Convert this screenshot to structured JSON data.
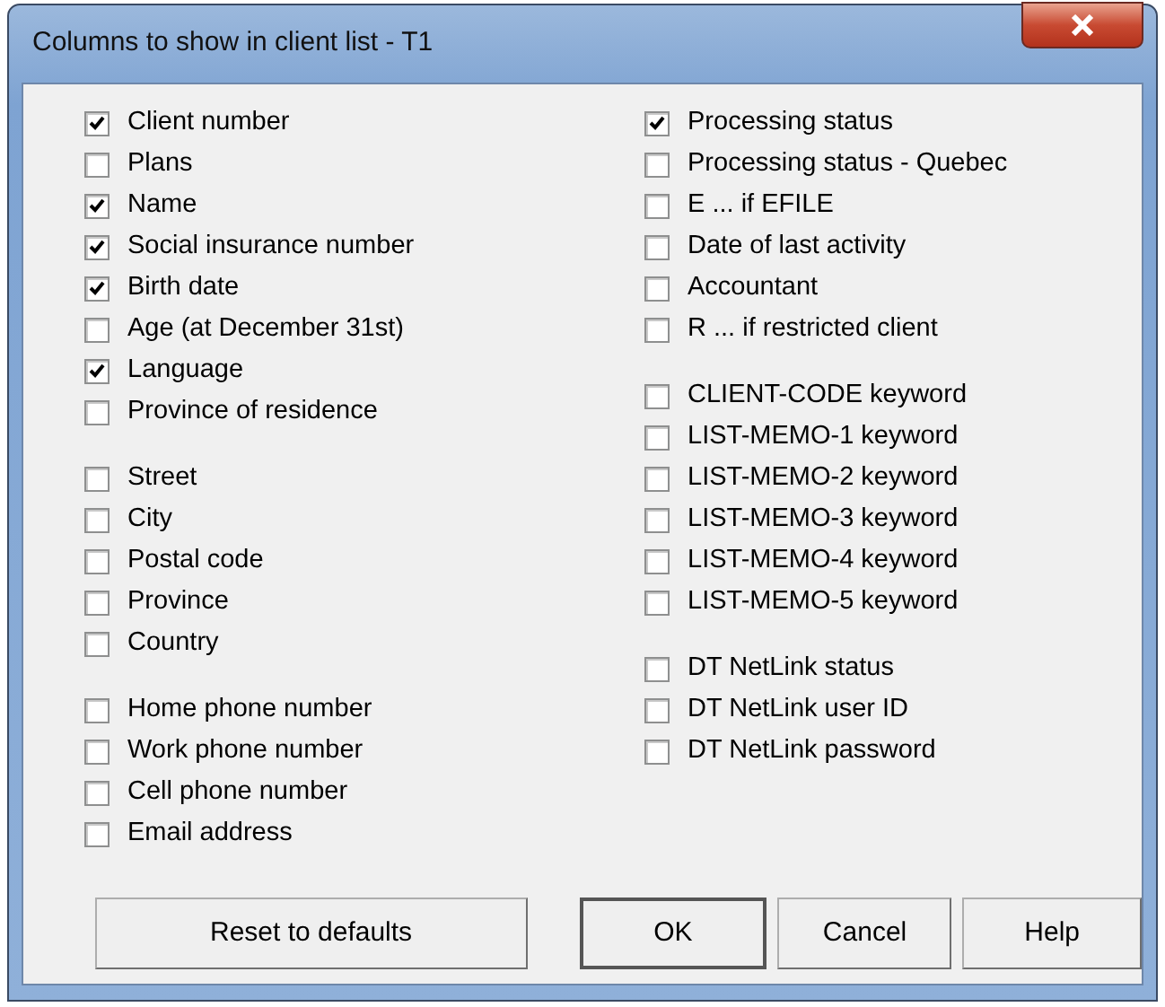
{
  "window": {
    "title": "Columns to show in client list - T1"
  },
  "columns": [
    {
      "groups": [
        [
          {
            "label": "Client number",
            "checked": true
          },
          {
            "label": "Plans",
            "checked": false
          },
          {
            "label": "Name",
            "checked": true
          },
          {
            "label": "Social insurance number",
            "checked": true
          },
          {
            "label": "Birth date",
            "checked": true
          },
          {
            "label": "Age (at December 31st)",
            "checked": false
          },
          {
            "label": "Language",
            "checked": true
          },
          {
            "label": "Province of residence",
            "checked": false
          }
        ],
        [
          {
            "label": "Street",
            "checked": false
          },
          {
            "label": "City",
            "checked": false
          },
          {
            "label": "Postal code",
            "checked": false
          },
          {
            "label": "Province",
            "checked": false
          },
          {
            "label": "Country",
            "checked": false
          }
        ],
        [
          {
            "label": "Home phone number",
            "checked": false
          },
          {
            "label": "Work phone number",
            "checked": false
          },
          {
            "label": "Cell phone number",
            "checked": false
          },
          {
            "label": "Email address",
            "checked": false
          }
        ]
      ]
    },
    {
      "groups": [
        [
          {
            "label": "Processing status",
            "checked": true
          },
          {
            "label": "Processing status - Quebec",
            "checked": false
          },
          {
            "label": "E ... if EFILE",
            "checked": false
          },
          {
            "label": "Date of last activity",
            "checked": false
          },
          {
            "label": "Accountant",
            "checked": false
          },
          {
            "label": "R ... if restricted client",
            "checked": false
          }
        ],
        [
          {
            "label": "CLIENT-CODE keyword",
            "checked": false
          },
          {
            "label": "LIST-MEMO-1 keyword",
            "checked": false
          },
          {
            "label": "LIST-MEMO-2 keyword",
            "checked": false
          },
          {
            "label": "LIST-MEMO-3 keyword",
            "checked": false
          },
          {
            "label": "LIST-MEMO-4 keyword",
            "checked": false
          },
          {
            "label": "LIST-MEMO-5 keyword",
            "checked": false
          }
        ],
        [
          {
            "label": "DT NetLink status",
            "checked": false
          },
          {
            "label": "DT NetLink user ID",
            "checked": false
          },
          {
            "label": "DT NetLink password",
            "checked": false
          }
        ]
      ]
    }
  ],
  "buttons": [
    {
      "label": "Reset to defaults",
      "default": false
    },
    {
      "label": "OK",
      "default": true
    },
    {
      "label": "Cancel",
      "default": false
    },
    {
      "label": "Help",
      "default": false
    }
  ]
}
